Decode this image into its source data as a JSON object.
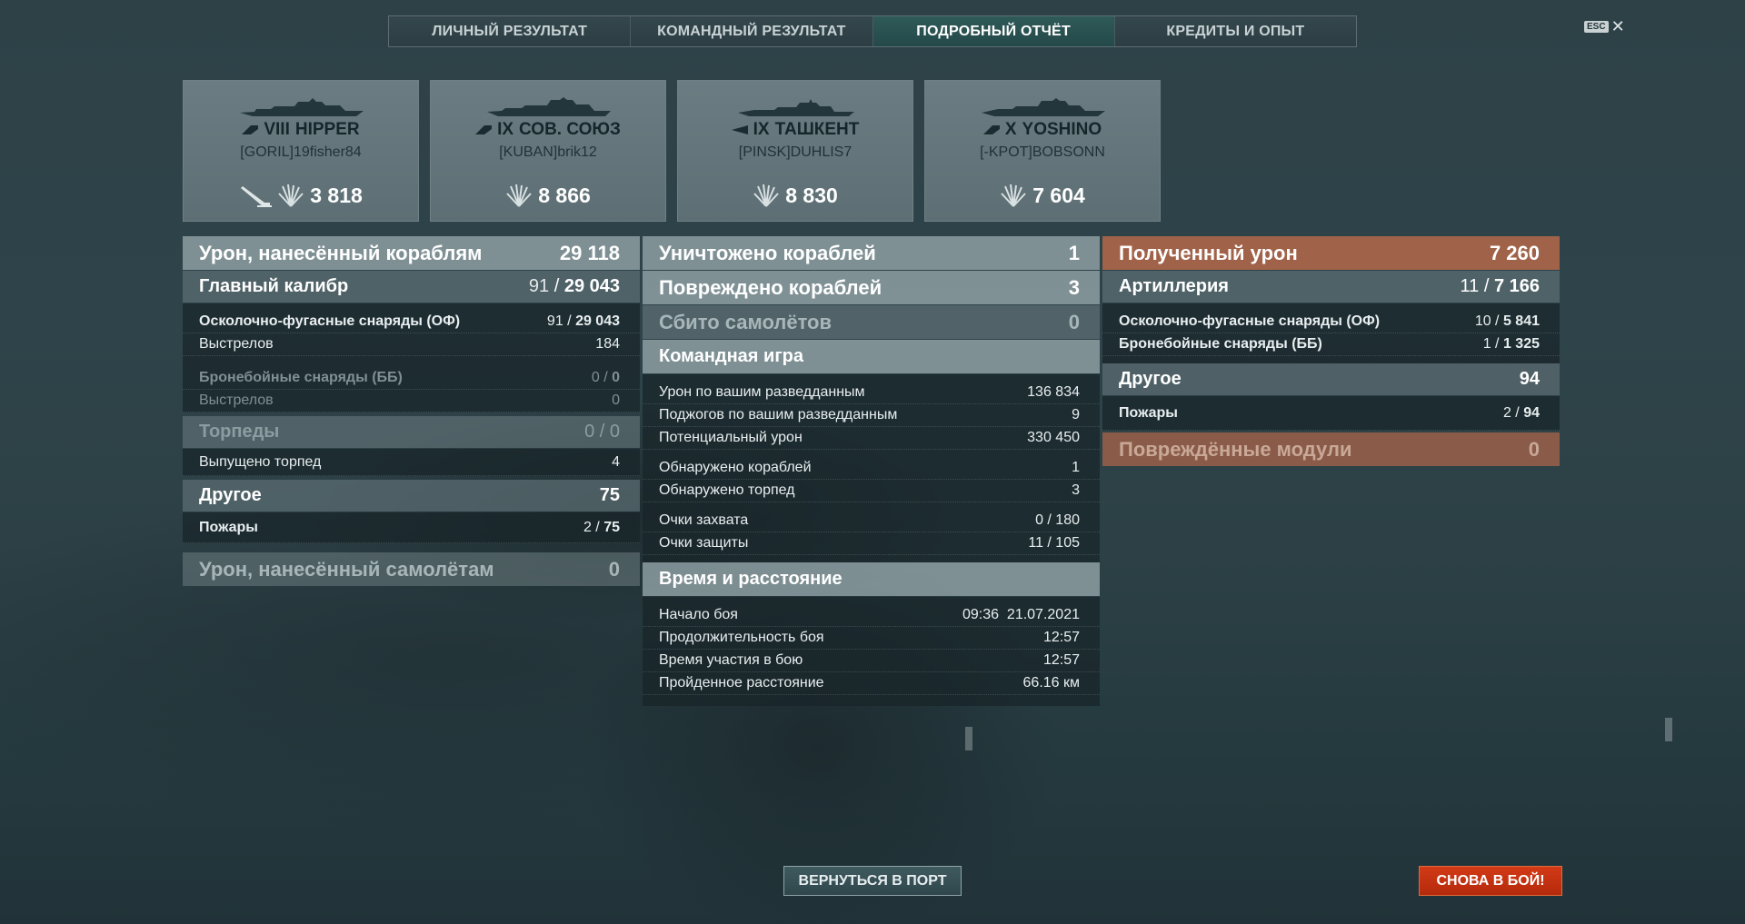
{
  "tabs": [
    {
      "label": "ЛИЧНЫЙ РЕЗУЛЬТАТ"
    },
    {
      "label": "КОМАНДНЫЙ РЕЗУЛЬТАТ"
    },
    {
      "label": "ПОДРОБНЫЙ ОТЧЁТ",
      "active": true
    },
    {
      "label": "КРЕДИТЫ И ОПЫТ"
    }
  ],
  "esc": {
    "key": "ESC",
    "close": "✕"
  },
  "cards": [
    {
      "tier": "VIII",
      "ship": "HIPPER",
      "player": "[GORIL]19fisher84",
      "score": "3 818",
      "torpedo_icon": true
    },
    {
      "tier": "IX",
      "ship": "СОВ. СОЮЗ",
      "player": "[KUBAN]brik12",
      "score": "8 866"
    },
    {
      "tier": "IX",
      "ship": "ТАШКЕНТ",
      "player": "[PINSK]DUHLIS7",
      "score": "8 830"
    },
    {
      "tier": "X",
      "ship": "YOSHINO",
      "player": "[-KPOT]BOBSONN",
      "score": "7 604"
    }
  ],
  "left": {
    "damage_ships": {
      "label": "Урон, нанесённый кораблям",
      "value": "29 118"
    },
    "main_caliber": {
      "label": "Главный калибр",
      "hits": "91",
      "value": "29 043"
    },
    "he": {
      "label": "Осколочно-фугасные снаряды (ОФ)",
      "hits": "91",
      "value": "29 043"
    },
    "he_shots": {
      "label": "Выстрелов",
      "value": "184"
    },
    "ap": {
      "label": "Бронебойные снаряды (ББ)",
      "hits": "0",
      "value": "0"
    },
    "ap_shots": {
      "label": "Выстрелов",
      "value": "0"
    },
    "torpedoes": {
      "label": "Торпеды",
      "hits": "0",
      "value": "0"
    },
    "torps_launched": {
      "label": "Выпущено торпед",
      "value": "4"
    },
    "other": {
      "label": "Другое",
      "value": "75"
    },
    "fires": {
      "label": "Пожары",
      "hits": "2",
      "value": "75"
    },
    "damage_planes": {
      "label": "Урон, нанесённый самолётам",
      "value": "0"
    }
  },
  "middle": {
    "destroyed": {
      "label": "Уничтожено кораблей",
      "value": "1"
    },
    "damaged": {
      "label": "Повреждено кораблей",
      "value": "3"
    },
    "planes": {
      "label": "Сбито самолётов",
      "value": "0"
    },
    "team": {
      "label": "Командная игра"
    },
    "scout_damage": {
      "label": "Урон по вашим разведданным",
      "value": "136 834"
    },
    "scout_fires": {
      "label": "Поджогов по вашим разведданным",
      "value": "9"
    },
    "potential": {
      "label": "Потенциальный урон",
      "value": "330 450"
    },
    "spotted_ships": {
      "label": "Обнаружено кораблей",
      "value": "1"
    },
    "spotted_torps": {
      "label": "Обнаружено торпед",
      "value": "3"
    },
    "capture": {
      "label": "Очки захвата",
      "value": "0 / 180"
    },
    "defense": {
      "label": "Очки защиты",
      "value": "11 / 105"
    },
    "time_header": {
      "label": "Время и расстояние"
    },
    "start": {
      "label": "Начало боя",
      "value": "09:36  21.07.2021"
    },
    "duration": {
      "label": "Продолжительность боя",
      "value": "12:57"
    },
    "participation": {
      "label": "Время участия в бою",
      "value": "12:57"
    },
    "distance": {
      "label": "Пройденное расстояние",
      "value": "66.16 км"
    }
  },
  "right": {
    "received": {
      "label": "Полученный урон",
      "value": "7 260"
    },
    "artillery": {
      "label": "Артиллерия",
      "hits": "11",
      "value": "7 166"
    },
    "he": {
      "label": "Осколочно-фугасные снаряды (ОФ)",
      "hits": "10",
      "value": "5 841"
    },
    "ap": {
      "label": "Бронебойные снаряды (ББ)",
      "hits": "1",
      "value": "1 325"
    },
    "other": {
      "label": "Другое",
      "value": "94"
    },
    "fires": {
      "label": "Пожары",
      "hits": "2",
      "value": "94"
    },
    "modules": {
      "label": "Повреждённые модули",
      "value": "0"
    }
  },
  "buttons": {
    "port": "ВЕРНУТЬСЯ В ПОРТ",
    "battle": "СНОВА В БОЙ!"
  },
  "colors": {
    "accent_tab": "#2f5a58",
    "battle_button": "#c8320f",
    "received_header": "#b06648"
  }
}
